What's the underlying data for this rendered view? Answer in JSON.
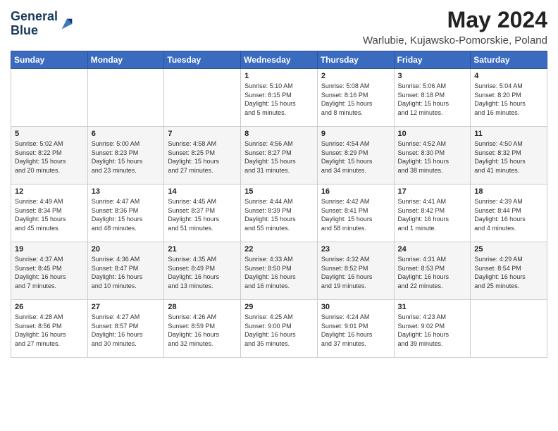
{
  "header": {
    "logo_line1": "General",
    "logo_line2": "Blue",
    "title": "May 2024",
    "subtitle": "Warlubie, Kujawsko-Pomorskie, Poland"
  },
  "columns": [
    "Sunday",
    "Monday",
    "Tuesday",
    "Wednesday",
    "Thursday",
    "Friday",
    "Saturday"
  ],
  "weeks": [
    [
      {
        "day": "",
        "info": ""
      },
      {
        "day": "",
        "info": ""
      },
      {
        "day": "",
        "info": ""
      },
      {
        "day": "1",
        "info": "Sunrise: 5:10 AM\nSunset: 8:15 PM\nDaylight: 15 hours\nand 5 minutes."
      },
      {
        "day": "2",
        "info": "Sunrise: 5:08 AM\nSunset: 8:16 PM\nDaylight: 15 hours\nand 8 minutes."
      },
      {
        "day": "3",
        "info": "Sunrise: 5:06 AM\nSunset: 8:18 PM\nDaylight: 15 hours\nand 12 minutes."
      },
      {
        "day": "4",
        "info": "Sunrise: 5:04 AM\nSunset: 8:20 PM\nDaylight: 15 hours\nand 16 minutes."
      }
    ],
    [
      {
        "day": "5",
        "info": "Sunrise: 5:02 AM\nSunset: 8:22 PM\nDaylight: 15 hours\nand 20 minutes."
      },
      {
        "day": "6",
        "info": "Sunrise: 5:00 AM\nSunset: 8:23 PM\nDaylight: 15 hours\nand 23 minutes."
      },
      {
        "day": "7",
        "info": "Sunrise: 4:58 AM\nSunset: 8:25 PM\nDaylight: 15 hours\nand 27 minutes."
      },
      {
        "day": "8",
        "info": "Sunrise: 4:56 AM\nSunset: 8:27 PM\nDaylight: 15 hours\nand 31 minutes."
      },
      {
        "day": "9",
        "info": "Sunrise: 4:54 AM\nSunset: 8:29 PM\nDaylight: 15 hours\nand 34 minutes."
      },
      {
        "day": "10",
        "info": "Sunrise: 4:52 AM\nSunset: 8:30 PM\nDaylight: 15 hours\nand 38 minutes."
      },
      {
        "day": "11",
        "info": "Sunrise: 4:50 AM\nSunset: 8:32 PM\nDaylight: 15 hours\nand 41 minutes."
      }
    ],
    [
      {
        "day": "12",
        "info": "Sunrise: 4:49 AM\nSunset: 8:34 PM\nDaylight: 15 hours\nand 45 minutes."
      },
      {
        "day": "13",
        "info": "Sunrise: 4:47 AM\nSunset: 8:36 PM\nDaylight: 15 hours\nand 48 minutes."
      },
      {
        "day": "14",
        "info": "Sunrise: 4:45 AM\nSunset: 8:37 PM\nDaylight: 15 hours\nand 51 minutes."
      },
      {
        "day": "15",
        "info": "Sunrise: 4:44 AM\nSunset: 8:39 PM\nDaylight: 15 hours\nand 55 minutes."
      },
      {
        "day": "16",
        "info": "Sunrise: 4:42 AM\nSunset: 8:41 PM\nDaylight: 15 hours\nand 58 minutes."
      },
      {
        "day": "17",
        "info": "Sunrise: 4:41 AM\nSunset: 8:42 PM\nDaylight: 16 hours\nand 1 minute."
      },
      {
        "day": "18",
        "info": "Sunrise: 4:39 AM\nSunset: 8:44 PM\nDaylight: 16 hours\nand 4 minutes."
      }
    ],
    [
      {
        "day": "19",
        "info": "Sunrise: 4:37 AM\nSunset: 8:45 PM\nDaylight: 16 hours\nand 7 minutes."
      },
      {
        "day": "20",
        "info": "Sunrise: 4:36 AM\nSunset: 8:47 PM\nDaylight: 16 hours\nand 10 minutes."
      },
      {
        "day": "21",
        "info": "Sunrise: 4:35 AM\nSunset: 8:49 PM\nDaylight: 16 hours\nand 13 minutes."
      },
      {
        "day": "22",
        "info": "Sunrise: 4:33 AM\nSunset: 8:50 PM\nDaylight: 16 hours\nand 16 minutes."
      },
      {
        "day": "23",
        "info": "Sunrise: 4:32 AM\nSunset: 8:52 PM\nDaylight: 16 hours\nand 19 minutes."
      },
      {
        "day": "24",
        "info": "Sunrise: 4:31 AM\nSunset: 8:53 PM\nDaylight: 16 hours\nand 22 minutes."
      },
      {
        "day": "25",
        "info": "Sunrise: 4:29 AM\nSunset: 8:54 PM\nDaylight: 16 hours\nand 25 minutes."
      }
    ],
    [
      {
        "day": "26",
        "info": "Sunrise: 4:28 AM\nSunset: 8:56 PM\nDaylight: 16 hours\nand 27 minutes."
      },
      {
        "day": "27",
        "info": "Sunrise: 4:27 AM\nSunset: 8:57 PM\nDaylight: 16 hours\nand 30 minutes."
      },
      {
        "day": "28",
        "info": "Sunrise: 4:26 AM\nSunset: 8:59 PM\nDaylight: 16 hours\nand 32 minutes."
      },
      {
        "day": "29",
        "info": "Sunrise: 4:25 AM\nSunset: 9:00 PM\nDaylight: 16 hours\nand 35 minutes."
      },
      {
        "day": "30",
        "info": "Sunrise: 4:24 AM\nSunset: 9:01 PM\nDaylight: 16 hours\nand 37 minutes."
      },
      {
        "day": "31",
        "info": "Sunrise: 4:23 AM\nSunset: 9:02 PM\nDaylight: 16 hours\nand 39 minutes."
      },
      {
        "day": "",
        "info": ""
      }
    ]
  ]
}
